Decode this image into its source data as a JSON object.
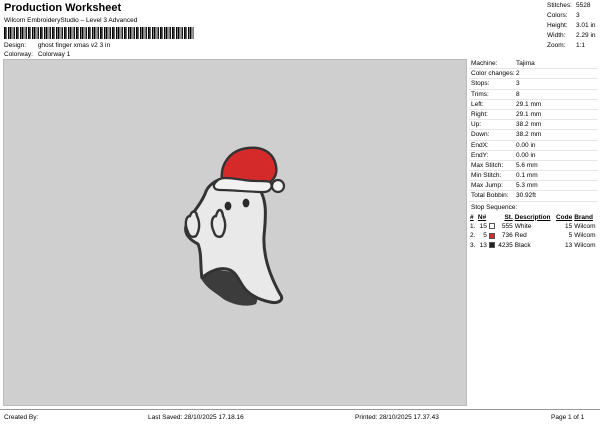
{
  "header": {
    "title": "Production Worksheet",
    "subtitle": "Wilcom EmbroideryStudio – Level 3 Advanced",
    "design_label": "Design:",
    "design_value": "ghost finger xmas v2 3 in",
    "colorway_label": "Colorway:",
    "colorway_value": "Colorway 1"
  },
  "stats": [
    {
      "label": "Stitches:",
      "value": "5528"
    },
    {
      "label": "Colors:",
      "value": "3"
    },
    {
      "label": "Height:",
      "value": "3.01 in"
    },
    {
      "label": "Width:",
      "value": "2.29 in"
    },
    {
      "label": "Zoom:",
      "value": "1:1"
    }
  ],
  "machine_info": [
    {
      "label": "Machine:",
      "value": "Tajima"
    },
    {
      "label": "Color changes:",
      "value": "2"
    },
    {
      "label": "Stops:",
      "value": "3"
    },
    {
      "label": "Trims:",
      "value": "8"
    },
    {
      "label": "Left:",
      "value": "29.1 mm"
    },
    {
      "label": "Right:",
      "value": "29.1 mm"
    },
    {
      "label": "Up:",
      "value": "38.2 mm"
    },
    {
      "label": "Down:",
      "value": "38.2 mm"
    },
    {
      "label": "EndX:",
      "value": "0.00 in"
    },
    {
      "label": "EndY:",
      "value": "0.00 in"
    },
    {
      "label": "Max Stitch:",
      "value": "5.6 mm"
    },
    {
      "label": "Min Stitch:",
      "value": "0.1 mm"
    },
    {
      "label": "Max Jump:",
      "value": "5.3 mm"
    },
    {
      "label": "Total Bobbin:",
      "value": "30.92ft"
    }
  ],
  "stop_sequence": {
    "title": "Stop Sequence:",
    "headers": {
      "num": "#",
      "n": "N#",
      "st": "St.",
      "description": "Description",
      "code": "Code",
      "brand": "Brand"
    },
    "rows": [
      {
        "num": "1.",
        "n": "15",
        "color": "#ffffff",
        "st": "555",
        "description": "White",
        "code": "15",
        "brand": "Wilcom"
      },
      {
        "num": "2.",
        "n": "5",
        "color": "#d42a2a",
        "st": "736",
        "description": "Red",
        "code": "5",
        "brand": "Wilcom"
      },
      {
        "num": "3.",
        "n": "13",
        "color": "#222222",
        "st": "4235",
        "description": "Black",
        "code": "13",
        "brand": "Wilcom"
      }
    ]
  },
  "footer": {
    "created_by": "Created By:",
    "last_saved": "Last Saved: 28/10/2025 17.18.16",
    "printed": "Printed: 28/10/2025 17.37.43",
    "page": "Page 1 of 1"
  },
  "colors": {
    "canvas_bg": "#cfcfcf",
    "hat_red": "#d42a2a",
    "outline": "#3a3a3a"
  }
}
